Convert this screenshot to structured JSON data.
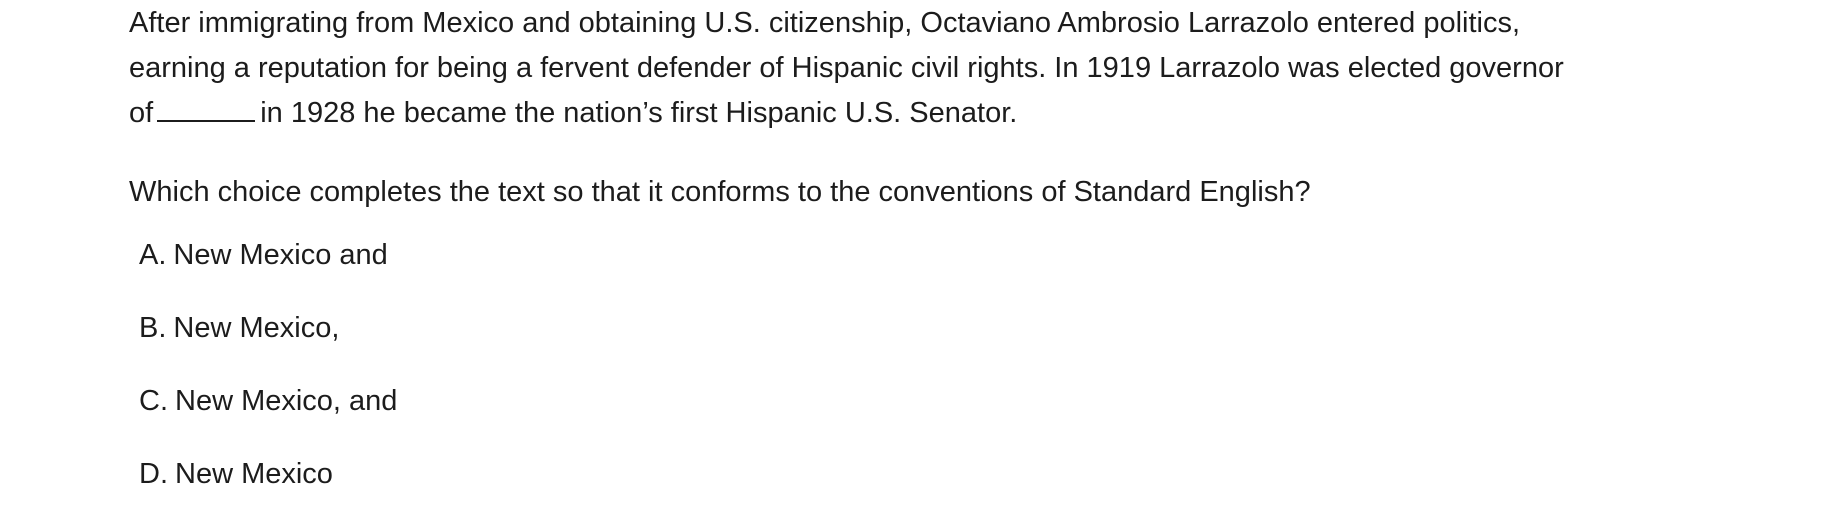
{
  "passage": {
    "line1": "After immigrating from Mexico and obtaining U.S. citizenship, Octaviano Ambrosio Larrazolo entered politics,",
    "line2": "earning a reputation for being a fervent defender of Hispanic civil rights. In 1919 Larrazolo was elected governor",
    "line3_before_blank": "of",
    "line3_after_blank": "in 1928 he became the nation’s first Hispanic U.S. Senator."
  },
  "question": "Which choice completes the text so that it conforms to the conventions of Standard English?",
  "choices": [
    {
      "letter": "A.",
      "text": "New Mexico and"
    },
    {
      "letter": "B.",
      "text": "New Mexico,"
    },
    {
      "letter": "C.",
      "text": "New Mexico, and"
    },
    {
      "letter": "D.",
      "text": "New Mexico"
    }
  ]
}
